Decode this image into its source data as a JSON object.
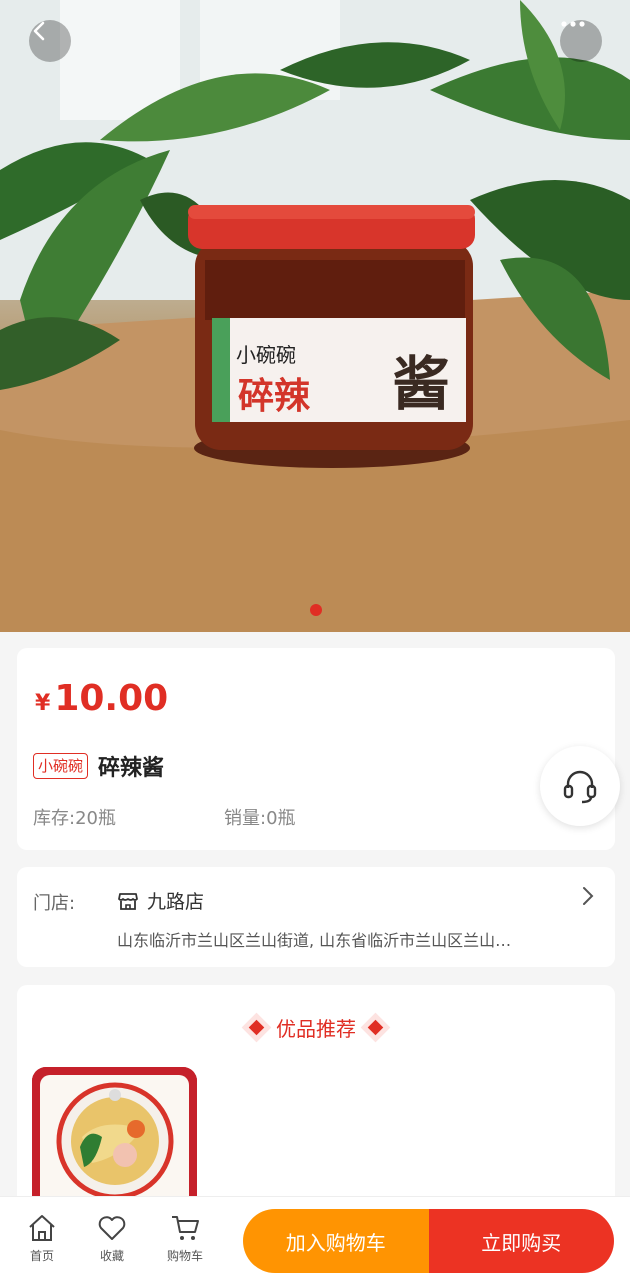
{
  "hero": {
    "jar_brand": "小碗碗",
    "jar_label": "碎辣酱",
    "carousel_index": 1,
    "carousel_total": 1
  },
  "product": {
    "currency": "¥",
    "price": "10.00",
    "brand_tag": "小碗碗",
    "title": "碎辣酱",
    "stock": "库存:20瓶",
    "sales": "销量:0瓶"
  },
  "store": {
    "label": "门店:",
    "name": "九路店",
    "address": "山东临沂市兰山区兰山街道, 山东省临沂市兰山区兰山…"
  },
  "recommend": {
    "title": "优品推荐"
  },
  "bottom_bar": {
    "home": "首页",
    "favorite": "收藏",
    "cart": "购物车",
    "add_to_cart": "加入购物车",
    "buy_now": "立即购买"
  },
  "colors": {
    "accent": "#e02e24",
    "add_to_cart": "#ff9402",
    "buy_now": "#ec3323"
  }
}
